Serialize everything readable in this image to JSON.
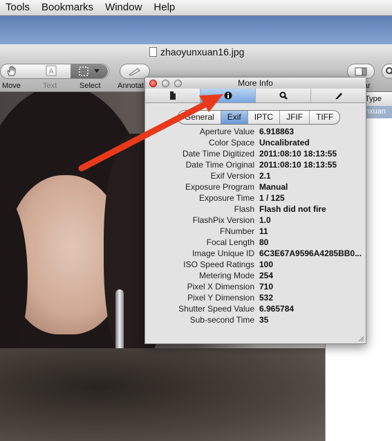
{
  "menubar": {
    "items": [
      "Tools",
      "Bookmarks",
      "Window",
      "Help"
    ]
  },
  "window": {
    "title": "zhaoyunxuan16.jpg",
    "toolbar": {
      "move_label": "Move",
      "text_label": "Text",
      "select_label": "Select",
      "annotate_label": "Annotat"
    },
    "sidebar": {
      "header_label": "Type",
      "partial_header_label": "ar",
      "selected_item": "nxuan"
    }
  },
  "inspector": {
    "title": "More Info",
    "tabs": [
      "document-icon",
      "info-icon",
      "magnifier-icon",
      "pen-icon"
    ],
    "active_tab_index": 1,
    "subtabs": [
      "General",
      "Exif",
      "IPTC",
      "JFIF",
      "TIFF"
    ],
    "active_subtab": "Exif",
    "rows": [
      {
        "key": "Aperture Value",
        "value": "6.918863"
      },
      {
        "key": "Color Space",
        "value": "Uncalibrated"
      },
      {
        "key": "Date Time Digitized",
        "value": "2011:08:10 18:13:55"
      },
      {
        "key": "Date Time Original",
        "value": "2011:08:10 18:13:55"
      },
      {
        "key": "Exif Version",
        "value": "2.1"
      },
      {
        "key": "Exposure Program",
        "value": "Manual"
      },
      {
        "key": "Exposure Time",
        "value": "1 / 125"
      },
      {
        "key": "Flash",
        "value": "Flash did not fire"
      },
      {
        "key": "FlashPix Version",
        "value": "1.0"
      },
      {
        "key": "FNumber",
        "value": "11"
      },
      {
        "key": "Focal Length",
        "value": "80"
      },
      {
        "key": "Image Unique ID",
        "value": "6C3E67A9596A4285BB0..."
      },
      {
        "key": "ISO Speed Ratings",
        "value": "100"
      },
      {
        "key": "Metering Mode",
        "value": "254"
      },
      {
        "key": "Pixel X Dimension",
        "value": "710"
      },
      {
        "key": "Pixel Y Dimension",
        "value": "532"
      },
      {
        "key": "Shutter Speed Value",
        "value": "6.965784"
      },
      {
        "key": "Sub-second Time",
        "value": "35"
      }
    ]
  },
  "colors": {
    "annotation_arrow": "#e8391d",
    "active_tab": "#76a7e0",
    "desktop": "#6f8db8"
  }
}
